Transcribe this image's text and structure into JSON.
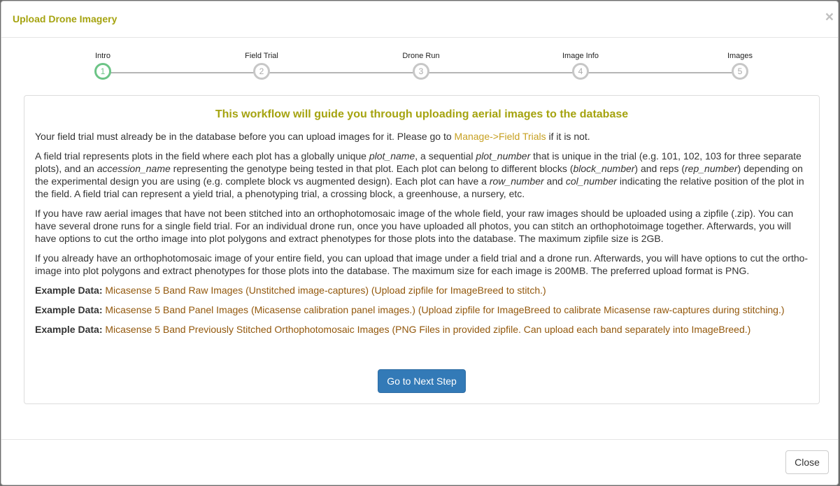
{
  "modal": {
    "title": "Upload Drone Imagery",
    "close_symbol": "×"
  },
  "steps": [
    {
      "label": "Intro",
      "number": "1",
      "active": true
    },
    {
      "label": "Field Trial",
      "number": "2",
      "active": false
    },
    {
      "label": "Drone Run",
      "number": "3",
      "active": false
    },
    {
      "label": "Image Info",
      "number": "4",
      "active": false
    },
    {
      "label": "Images",
      "number": "5",
      "active": false
    }
  ],
  "content": {
    "heading": "This workflow will guide you through uploading aerial images to the database",
    "p1": {
      "before": "Your field trial must already be in the database before you can upload images for it. Please go to ",
      "link": "Manage->Field Trials",
      "after": " if it is not."
    },
    "p2": {
      "t1": "A field trial represents plots in the field where each plot has a globally unique ",
      "i1": "plot_name",
      "t2": ", a sequential ",
      "i2": "plot_number",
      "t3": " that is unique in the trial (e.g. 101, 102, 103 for three separate plots), and an ",
      "i3": "accession_name",
      "t4": " representing the genotype being tested in that plot. Each plot can belong to different blocks (",
      "i4": "block_number",
      "t5": ") and reps (",
      "i5": "rep_number",
      "t6": ") depending on the experimental design you are using (e.g. complete block vs augmented design). Each plot can have a ",
      "i6": "row_number",
      "t7": " and ",
      "i7": "col_number",
      "t8": " indicating the relative position of the plot in the field. A field trial can represent a yield trial, a phenotyping trial, a crossing block, a greenhouse, a nursery, etc."
    },
    "p3": "If you have raw aerial images that have not been stitched into an orthophotomosaic image of the whole field, your raw images should be uploaded using a zipfile (.zip). You can have several drone runs for a single field trial. For an individual drone run, once you have uploaded all photos, you can stitch an orthophotoimage together. Afterwards, you will have options to cut the ortho image into plot polygons and extract phenotypes for those plots into the database. The maximum zipfile size is 2GB.",
    "p4": "If you already have an orthophotomosaic image of your entire field, you can upload that image under a field trial and a drone run. Afterwards, you will have options to cut the ortho-image into plot polygons and extract phenotypes for those plots into the database. The maximum size for each image is 200MB. The preferred upload format is PNG.",
    "examples": [
      {
        "label": "Example Data:",
        "link": "Micasense 5 Band Raw Images (Unstitched image-captures) (Upload zipfile for ImageBreed to stitch.)"
      },
      {
        "label": "Example Data:",
        "link": "Micasense 5 Band Panel Images (Micasense calibration panel images.) (Upload zipfile for ImageBreed to calibrate Micasense raw-captures during stitching.)"
      },
      {
        "label": "Example Data:",
        "link": "Micasense 5 Band Previously Stitched Orthophotomosaic Images (PNG Files in provided zipfile. Can upload each band separately into ImageBreed.)"
      }
    ],
    "next_button": "Go to Next Step"
  },
  "footer": {
    "close_button": "Close"
  },
  "colors": {
    "title": "#a5a30f",
    "link": "#c7a021",
    "example_link": "#93580c",
    "primary_button": "#337ab7",
    "active_step": "#6cc486"
  }
}
